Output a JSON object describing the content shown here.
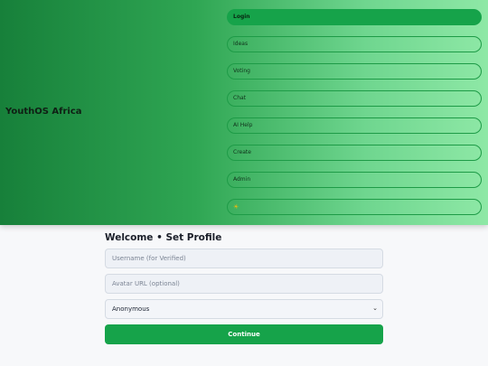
{
  "app": {
    "brand": "YouthOS Africa"
  },
  "nav": {
    "items": [
      {
        "label": "Login",
        "active": true
      },
      {
        "label": "Ideas",
        "active": false
      },
      {
        "label": "Voting",
        "active": false
      },
      {
        "label": "Chat",
        "active": false
      },
      {
        "label": "AI Help",
        "active": false
      },
      {
        "label": "Create",
        "active": false
      },
      {
        "label": "Admin",
        "active": false
      }
    ],
    "theme_icon": "sun-icon",
    "theme_glyph": "☀"
  },
  "profile": {
    "title": "Welcome • Set Profile",
    "username_placeholder": "Username (for Verified)",
    "avatar_placeholder": "Avatar URL (optional)",
    "identity_selected": "Anonymous",
    "continue_label": "Continue"
  },
  "colors": {
    "accent": "#16a34a",
    "header_start": "#17803a",
    "header_end": "#8ee8a6"
  }
}
